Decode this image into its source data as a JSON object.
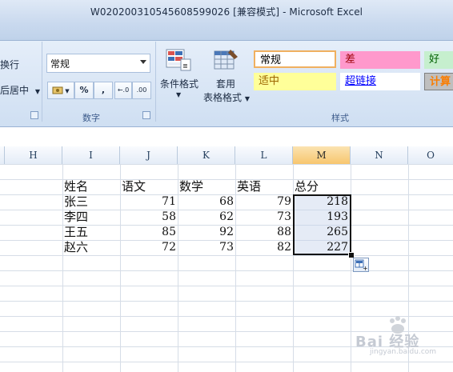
{
  "window": {
    "title": "W020200310545608599026  [兼容模式] - Microsoft Excel"
  },
  "ribbon": {
    "alignment": {
      "wrap_text": "换行",
      "merge_center": "后居中"
    },
    "number": {
      "format_value": "常规",
      "percent_label": "%",
      "comma_label": ",",
      "inc_decimal": "←.0 .00",
      "dec_decimal": ".00 →.0",
      "group_label": "数字"
    },
    "styles": {
      "conditional_format": "条件格式",
      "format_as_table_line1": "套用",
      "format_as_table_line2": "表格格式",
      "group_label": "样式",
      "cells": [
        {
          "label": "常规",
          "bg": "#ffffff",
          "color": "#111111"
        },
        {
          "label": "差",
          "bg": "#ff99cc",
          "color": "#9c0006"
        },
        {
          "label": "好",
          "bg": "#c6efce",
          "color": "#006100"
        },
        {
          "label": "适中",
          "bg": "#ffff99",
          "color": "#9c6500"
        },
        {
          "label": "超链接",
          "bg": "#ffffff",
          "color": "#0000ff"
        },
        {
          "label": "计算",
          "bg": "#bfbfbf",
          "color": "#fa7d00"
        }
      ]
    }
  },
  "columns": [
    "H",
    "I",
    "J",
    "K",
    "L",
    "M",
    "N",
    "O"
  ],
  "selected_column": "M",
  "table": {
    "headers": [
      "姓名",
      "语文",
      "数学",
      "英语",
      "总分"
    ],
    "rows": [
      [
        "张三",
        "71",
        "68",
        "79",
        "218"
      ],
      [
        "李四",
        "58",
        "62",
        "73",
        "193"
      ],
      [
        "王五",
        "85",
        "92",
        "88",
        "265"
      ],
      [
        "赵六",
        "72",
        "73",
        "82",
        "227"
      ]
    ]
  },
  "colors": {
    "selection_border": "#111111",
    "selected_header": "#f7c66e"
  },
  "watermark": {
    "text": "Bai 经验",
    "sub": "jingyan.baidu.com"
  }
}
